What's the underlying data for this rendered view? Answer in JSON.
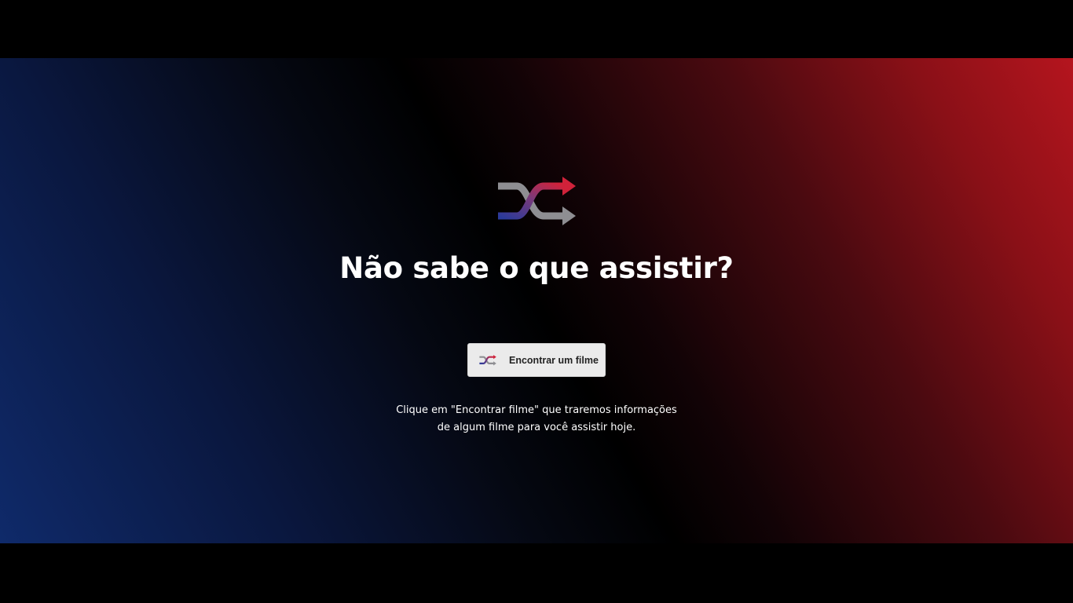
{
  "hero": {
    "icon": "shuffle-icon",
    "title": "Não sabe o que assistir?"
  },
  "action": {
    "icon": "shuffle-icon",
    "label": "Encontrar um filme"
  },
  "caption": {
    "line1": "Clique em \"Encontrar filme\" que traremos informações",
    "line2": "de algum filme para você assistir hoje."
  },
  "colors": {
    "blue": "#0f2a6a",
    "red": "#b5151e",
    "button_bg": "#ebebeb",
    "text": "#ffffff"
  }
}
